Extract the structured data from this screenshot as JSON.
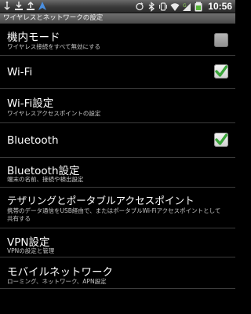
{
  "status_bar": {
    "left_icons": [
      "usb-icon",
      "download-icon",
      "upload-icon",
      "navigation-arrow-icon"
    ],
    "right_icons": [
      "sync-icon",
      "bluetooth-icon",
      "vibrate-icon",
      "wifi-icon",
      "signal-icon",
      "battery-icon"
    ],
    "time": "10:56"
  },
  "title": "ワイヤレスとネットワークの設定",
  "items": [
    {
      "title": "機内モード",
      "summary": "ワイヤレス接続をすべて無効にする",
      "checkbox": "unchecked-disabled"
    },
    {
      "title": "Wi-Fi",
      "summary": "",
      "checkbox": "checked"
    },
    {
      "title": "Wi-Fi設定",
      "summary": "ワイヤレスアクセスポイントの設定",
      "checkbox": ""
    },
    {
      "title": "Bluetooth",
      "summary": "",
      "checkbox": "checked"
    },
    {
      "title": "Bluetooth設定",
      "summary": "端末の名前、接続や検出設定",
      "checkbox": ""
    },
    {
      "title": "テザリングとポータブルアクセスポイント",
      "summary": "携帯のデータ通信をUSB経由で、またはポータブルWi-Fiアクセスポイントとして共有する",
      "checkbox": ""
    },
    {
      "title": "VPN設定",
      "summary": "VPNの設定と管理",
      "checkbox": ""
    },
    {
      "title": "モバイルネットワーク",
      "summary": "ローミング、ネットワーク、APN設定",
      "checkbox": ""
    }
  ],
  "colors": {
    "background": "#000000",
    "check": "#3aa53a",
    "divider": "#3c3c3c"
  }
}
